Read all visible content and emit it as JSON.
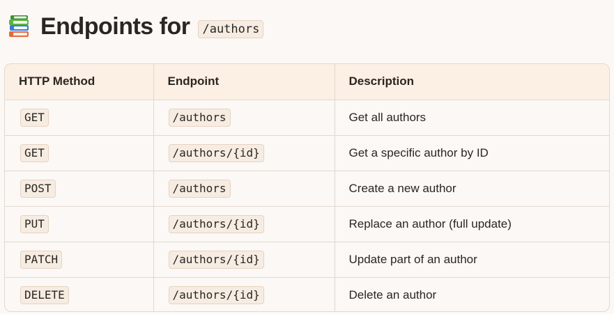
{
  "page": {
    "heading": "Endpoints for",
    "heading_code": "/authors",
    "icon": "books-icon"
  },
  "table": {
    "columns": [
      "HTTP Method",
      "Endpoint",
      "Description"
    ],
    "rows": [
      {
        "method": "GET",
        "endpoint": "/authors",
        "description": "Get all authors"
      },
      {
        "method": "GET",
        "endpoint": "/authors/{id}",
        "description": "Get a specific author by ID"
      },
      {
        "method": "POST",
        "endpoint": "/authors",
        "description": "Create a new author"
      },
      {
        "method": "PUT",
        "endpoint": "/authors/{id}",
        "description": "Replace an author (full update)"
      },
      {
        "method": "PATCH",
        "endpoint": "/authors/{id}",
        "description": "Update part of an author"
      },
      {
        "method": "DELETE",
        "endpoint": "/authors/{id}",
        "description": "Delete an author"
      }
    ]
  },
  "colors": {
    "header_bg": "#fcefe4",
    "code_bg": "#f6ece2",
    "border": "#e2d8cf"
  }
}
